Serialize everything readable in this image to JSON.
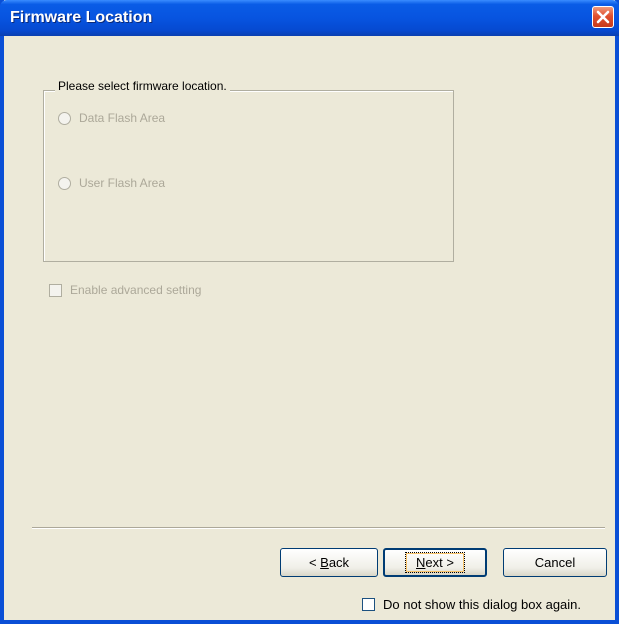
{
  "window": {
    "title": "Firmware Location",
    "close_symbol": "×"
  },
  "group": {
    "legend": "Please select firmware location.",
    "options": [
      {
        "label": "Data Flash Area",
        "selected": false,
        "enabled": false
      },
      {
        "label": "User Flash Area",
        "selected": false,
        "enabled": false
      }
    ]
  },
  "advanced": {
    "label": "Enable advanced setting",
    "checked": false,
    "enabled": false
  },
  "buttons": {
    "back": {
      "prefix": "< ",
      "accel": "B",
      "rest": "ack"
    },
    "next": {
      "accel": "N",
      "rest": "ext >"
    },
    "cancel": "Cancel"
  },
  "footer": {
    "dont_show_label": "Do not show this dialog box again.",
    "checked": false
  },
  "colors": {
    "title_bar": "#0754e0",
    "dialog_bg": "#ece9d8",
    "close_button": "#e0502f",
    "disabled_text": "#aca899"
  }
}
